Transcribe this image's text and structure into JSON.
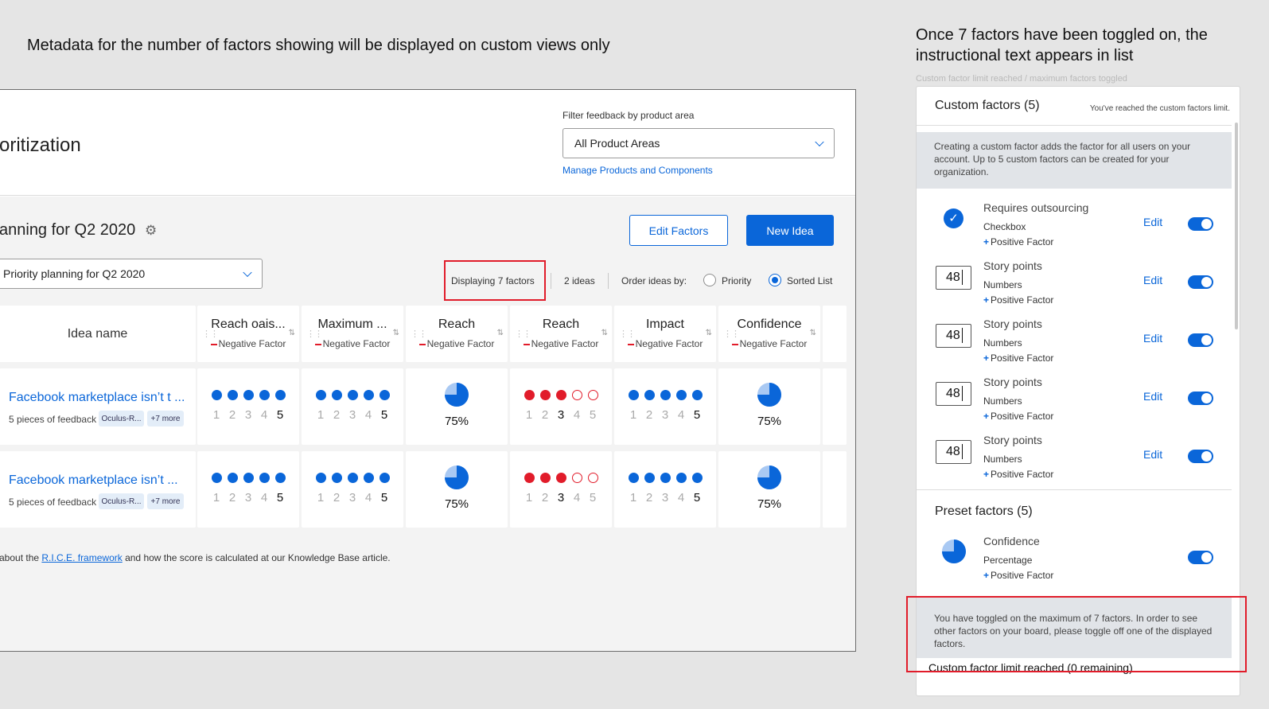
{
  "annotations": {
    "left": "Metadata for the number of factors showing will be displayed on custom views only",
    "right": "Once 7 factors have been toggled on, the instructional text appears in list",
    "right_sub": "Custom factor limit reached / maximum factors toggled"
  },
  "board": {
    "page_title": "oritization",
    "filter_label": "Filter feedback by product area",
    "filter_value": "All Product Areas",
    "manage_link": "Manage Products and Components",
    "plan_title": "anning for Q2 2020",
    "edit_factors": "Edit Factors",
    "new_idea": "New Idea",
    "plan_select": "Priority planning for Q2 2020",
    "displaying": "Displaying 7 factors",
    "ideas_count": "2 ideas",
    "order_by": "Order ideas by:",
    "order_priority": "Priority",
    "order_sorted": "Sorted List",
    "order_selected": "Sorted List",
    "idea_name_header": "Idea name",
    "columns": [
      {
        "title": "Reach oais...",
        "sub": "Negative Factor"
      },
      {
        "title": "Maximum ...",
        "sub": "Negative Factor"
      },
      {
        "title": "Reach",
        "sub": "Negative Factor"
      },
      {
        "title": "Reach",
        "sub": "Negative Factor"
      },
      {
        "title": "Impact",
        "sub": "Negative Factor"
      },
      {
        "title": "Confidence",
        "sub": "Negative Factor"
      }
    ],
    "rows": [
      {
        "name": "Facebook marketplace isn’t t ...",
        "feedback": "5 pieces of feedback",
        "tag": "Oculus-R...",
        "more": "+7 more",
        "scale_numbers": [
          "1",
          "2",
          "3",
          "4",
          "5"
        ],
        "scores": [
          5,
          5,
          0.75,
          3,
          5,
          0.75
        ],
        "percent_labels": [
          "75%",
          "75%"
        ]
      },
      {
        "name": "Facebook marketplace isn’t ...",
        "feedback": "5 pieces of feedback",
        "tag": "Oculus-R...",
        "more": "+7 more",
        "scale_numbers": [
          "1",
          "2",
          "3",
          "4",
          "5"
        ],
        "scores": [
          5,
          5,
          0.75,
          3,
          5,
          0.75
        ],
        "percent_labels": [
          "75%",
          "75%"
        ]
      }
    ],
    "footnote_before": "about the ",
    "footnote_link": "R.I.C.E. framework",
    "footnote_after": " and how the score is calculated at our Knowledge Base article."
  },
  "panel": {
    "custom_header": "Custom factors (5)",
    "custom_limit_note": "You've reached the custom factors limit.",
    "info_top": "Creating a custom factor adds the factor for all users on your account. Up to 5 custom factors can be created for your organization.",
    "factors": [
      {
        "name": "Requires outsourcing",
        "type": "Checkbox",
        "positive": "Positive Factor",
        "edit": "Edit",
        "value": "",
        "on": true
      },
      {
        "name": "Story points",
        "type": "Numbers",
        "positive": "Positive Factor",
        "edit": "Edit",
        "value": "48",
        "on": true
      },
      {
        "name": "Story points",
        "type": "Numbers",
        "positive": "Positive Factor",
        "edit": "Edit",
        "value": "48",
        "on": true
      },
      {
        "name": "Story points",
        "type": "Numbers",
        "positive": "Positive Factor",
        "edit": "Edit",
        "value": "48",
        "on": true
      },
      {
        "name": "Story points",
        "type": "Numbers",
        "positive": "Positive Factor",
        "edit": "Edit",
        "value": "48",
        "on": true
      }
    ],
    "preset_header": "Preset factors (5)",
    "preset": {
      "name": "Confidence",
      "type": "Percentage",
      "positive": "Positive Factor",
      "on": true,
      "value": 0.75
    },
    "info_bottom": "You have toggled on the maximum of 7 factors. In order to see other factors on your board, please toggle off one of the displayed factors.",
    "limit_footer": "Custom factor limit reached (0 remaining)"
  },
  "colors": {
    "accent": "#0a66d9",
    "negative": "#e11c2a",
    "highlight": "#e11c2a"
  },
  "icons": {
    "settings": "gear-icon",
    "check": "check-icon",
    "chevron": "chevron-down-icon",
    "drag": "drag-handle-icon",
    "sort": "sort-icon"
  }
}
